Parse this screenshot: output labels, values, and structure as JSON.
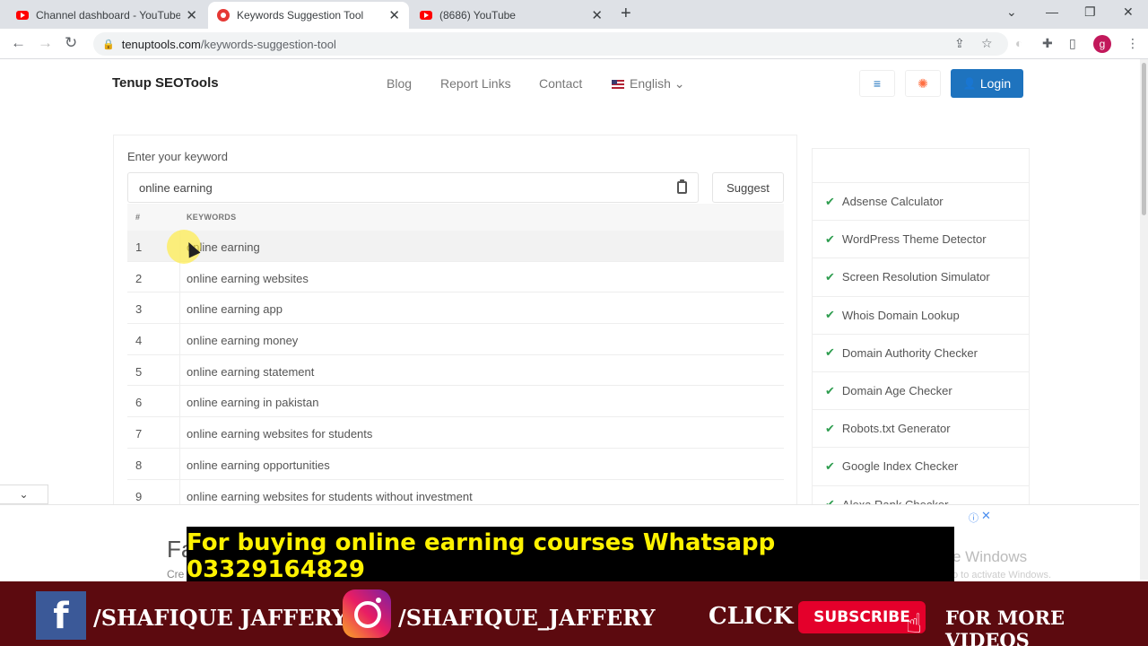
{
  "browser": {
    "tabs": [
      {
        "title": "Channel dashboard - YouTube St",
        "icon": "youtube-icon"
      },
      {
        "title": "Keywords Suggestion Tool",
        "icon": "tool-icon"
      },
      {
        "title": "(8686) YouTube",
        "icon": "youtube-icon"
      }
    ],
    "url_host": "tenuptools.com",
    "url_path": "/keywords-suggestion-tool",
    "profile_initial": "g"
  },
  "site": {
    "brand": "Tenup SEOTools",
    "nav": [
      "Blog",
      "Report Links",
      "Contact"
    ],
    "language": "English",
    "login_label": "Login"
  },
  "tool": {
    "label": "Enter your keyword",
    "input_value": "online earning",
    "suggest_label": "Suggest",
    "col_num": "#",
    "col_keywords": "KEYWORDS",
    "rows": [
      {
        "n": "1",
        "kw": "online earning"
      },
      {
        "n": "2",
        "kw": "online earning websites"
      },
      {
        "n": "3",
        "kw": "online earning app"
      },
      {
        "n": "4",
        "kw": "online earning money"
      },
      {
        "n": "5",
        "kw": "online earning statement"
      },
      {
        "n": "6",
        "kw": "online earning in pakistan"
      },
      {
        "n": "7",
        "kw": "online earning websites for students"
      },
      {
        "n": "8",
        "kw": "online earning opportunities"
      },
      {
        "n": "9",
        "kw": "online earning websites for students without investment"
      }
    ]
  },
  "sidebar": {
    "items": [
      "Adsense Calculator",
      "WordPress Theme Detector",
      "Screen Resolution Simulator",
      "Whois Domain Lookup",
      "Domain Authority Checker",
      "Domain Age Checker",
      "Robots.txt Generator",
      "Google Index Checker",
      "Alexa Rank Checker"
    ]
  },
  "ad": {
    "text_partial": "Fa",
    "sub_partial": "Cre",
    "watermark": "e Windows",
    "watermark_sub": "o to activate Windows."
  },
  "overlay": {
    "promo": "For buying online earning courses Whatsapp 03329164829",
    "facebook": "/SHAFIQUE JAFFERY",
    "instagram": "/SHAFIQUE_JAFFERY",
    "click": "CLICK",
    "subscribe": "SUBSCRIBE",
    "more": "FOR MORE VIDEOS"
  },
  "colors": {
    "login_button": "#1e73be",
    "check": "#2e9d4f",
    "promo_text": "#fff200",
    "bottom_bar": "#5c0a0f",
    "subscribe": "#e4002b"
  }
}
